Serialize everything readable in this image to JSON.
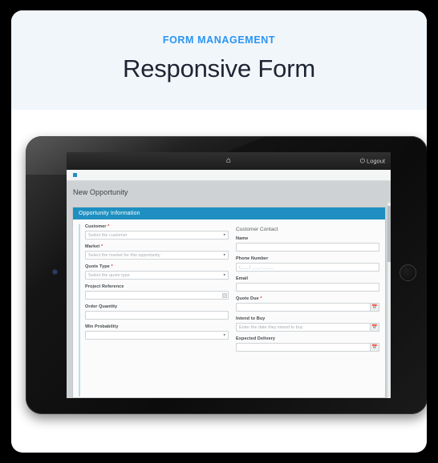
{
  "header": {
    "eyebrow": "FORM MANAGEMENT",
    "headline": "Responsive Form",
    "accent_color": "#2a95f2",
    "background": "#f1f6fb"
  },
  "device": {
    "type": "tablet",
    "camera": "camera-dot",
    "home_button": "home-button"
  },
  "navbar": {
    "home_icon": "home-icon",
    "power_icon": "power-icon",
    "logout_label": "Logout"
  },
  "breadcrumb": {
    "marker": "breadcrumb-dot"
  },
  "page": {
    "title": "New Opportunity"
  },
  "panel": {
    "heading": "Opportunity Information",
    "heading_color": "#1e8fc0"
  },
  "left_column": {
    "fields": [
      {
        "label": "Customer",
        "required": true,
        "type": "select",
        "placeholder": "Select the customer",
        "value": ""
      },
      {
        "label": "Market",
        "required": true,
        "type": "select",
        "placeholder": "Select the market for this opportunity",
        "value": ""
      },
      {
        "label": "Quote Type",
        "required": true,
        "type": "select",
        "placeholder": "Select the quote type",
        "value": ""
      },
      {
        "label": "Project Reference",
        "required": false,
        "type": "text-addon",
        "placeholder": "",
        "value": ""
      },
      {
        "label": "Order Quantity",
        "required": false,
        "type": "text",
        "placeholder": "",
        "value": ""
      },
      {
        "label": "Win Probability",
        "required": false,
        "type": "select",
        "placeholder": "",
        "value": ""
      }
    ]
  },
  "right_column": {
    "section_heading": "Customer Contact",
    "fields": [
      {
        "label": "Name",
        "required": false,
        "type": "text",
        "placeholder": "",
        "value": ""
      },
      {
        "label": "Phone Number",
        "required": false,
        "type": "mask",
        "placeholder": "(___) ___-____",
        "value": ""
      },
      {
        "label": "Email",
        "required": false,
        "type": "text",
        "placeholder": "",
        "value": ""
      },
      {
        "label": "Quote Due",
        "required": true,
        "type": "date",
        "placeholder": "",
        "value": ""
      },
      {
        "label": "Intend to Buy",
        "required": false,
        "type": "date",
        "placeholder": "Enter the date they intend to buy",
        "value": ""
      },
      {
        "label": "Expected Delivery",
        "required": false,
        "type": "date",
        "placeholder": "",
        "value": ""
      }
    ]
  },
  "icons": {
    "calendar": "calendar-icon",
    "caret_down": "chevron-down-icon",
    "search_addon": "lookup-icon"
  }
}
